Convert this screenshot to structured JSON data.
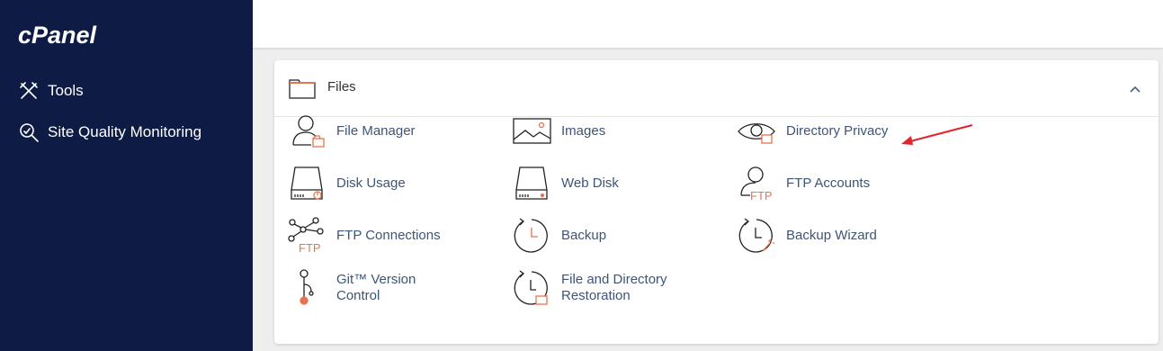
{
  "brand": {
    "logo_text": "cPanel"
  },
  "sidebar": {
    "items": [
      {
        "label": "Tools",
        "icon": "tools-icon"
      },
      {
        "label": "Site Quality Monitoring",
        "icon": "magnifier-icon"
      }
    ]
  },
  "panel": {
    "title": "Files",
    "items": [
      {
        "label": "File Manager",
        "icon": "file-manager-icon"
      },
      {
        "label": "Images",
        "icon": "image-icon"
      },
      {
        "label": "Directory Privacy",
        "icon": "eye-folder-icon"
      },
      {
        "label": "Disk Usage",
        "icon": "disk-usage-icon"
      },
      {
        "label": "Web Disk",
        "icon": "web-disk-icon"
      },
      {
        "label": "FTP Accounts",
        "icon": "ftp-accounts-icon"
      },
      {
        "label": "FTP Connections",
        "icon": "ftp-connections-icon"
      },
      {
        "label": "Backup",
        "icon": "backup-icon"
      },
      {
        "label": "Backup Wizard",
        "icon": "backup-wizard-icon"
      },
      {
        "label": "Git™ Version Control",
        "icon": "git-icon"
      },
      {
        "label": "File and Directory Restoration",
        "icon": "restore-icon"
      }
    ]
  },
  "colors": {
    "sidebar_bg": "#0e1c45",
    "link_text": "#3d5577",
    "accent_orange": "#e8744f",
    "annotation_arrow": "#e0242a"
  }
}
